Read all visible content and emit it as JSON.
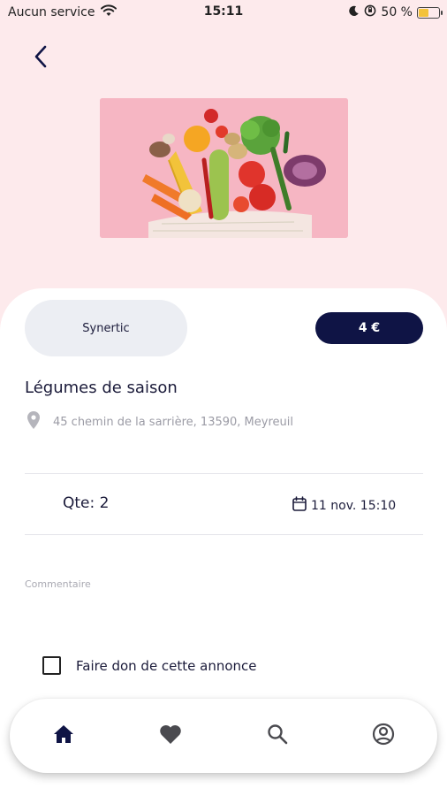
{
  "status_bar": {
    "carrier": "Aucun service",
    "time": "15:11",
    "battery_percent": "50 %",
    "battery_level": 0.5,
    "icons": [
      "wifi-icon",
      "moon-icon",
      "orientation-lock-icon",
      "battery-icon"
    ]
  },
  "header": {
    "back_icon": "chevron-left-icon"
  },
  "product": {
    "image": "vegetables-in-mesh-bag-photo",
    "shop_name": "Synertic",
    "price": "4 €",
    "title": "Légumes de saison",
    "address": "45 chemin de la sarrière, 13590, Meyreuil",
    "quantity": "Qte: 2",
    "date": "11 nov. 15:10",
    "comment_label": "Commentaire",
    "donate_label": "Faire don de cette annonce",
    "donate_checked": false
  },
  "colors": {
    "top_background": "#fdeaec",
    "accent": "#0f1445",
    "pill_gray": "#eceef3"
  },
  "nav": {
    "items": [
      {
        "icon": "home-icon",
        "active": true
      },
      {
        "icon": "heart-icon",
        "active": false
      },
      {
        "icon": "search-icon",
        "active": false
      },
      {
        "icon": "account-icon",
        "active": false
      }
    ]
  }
}
